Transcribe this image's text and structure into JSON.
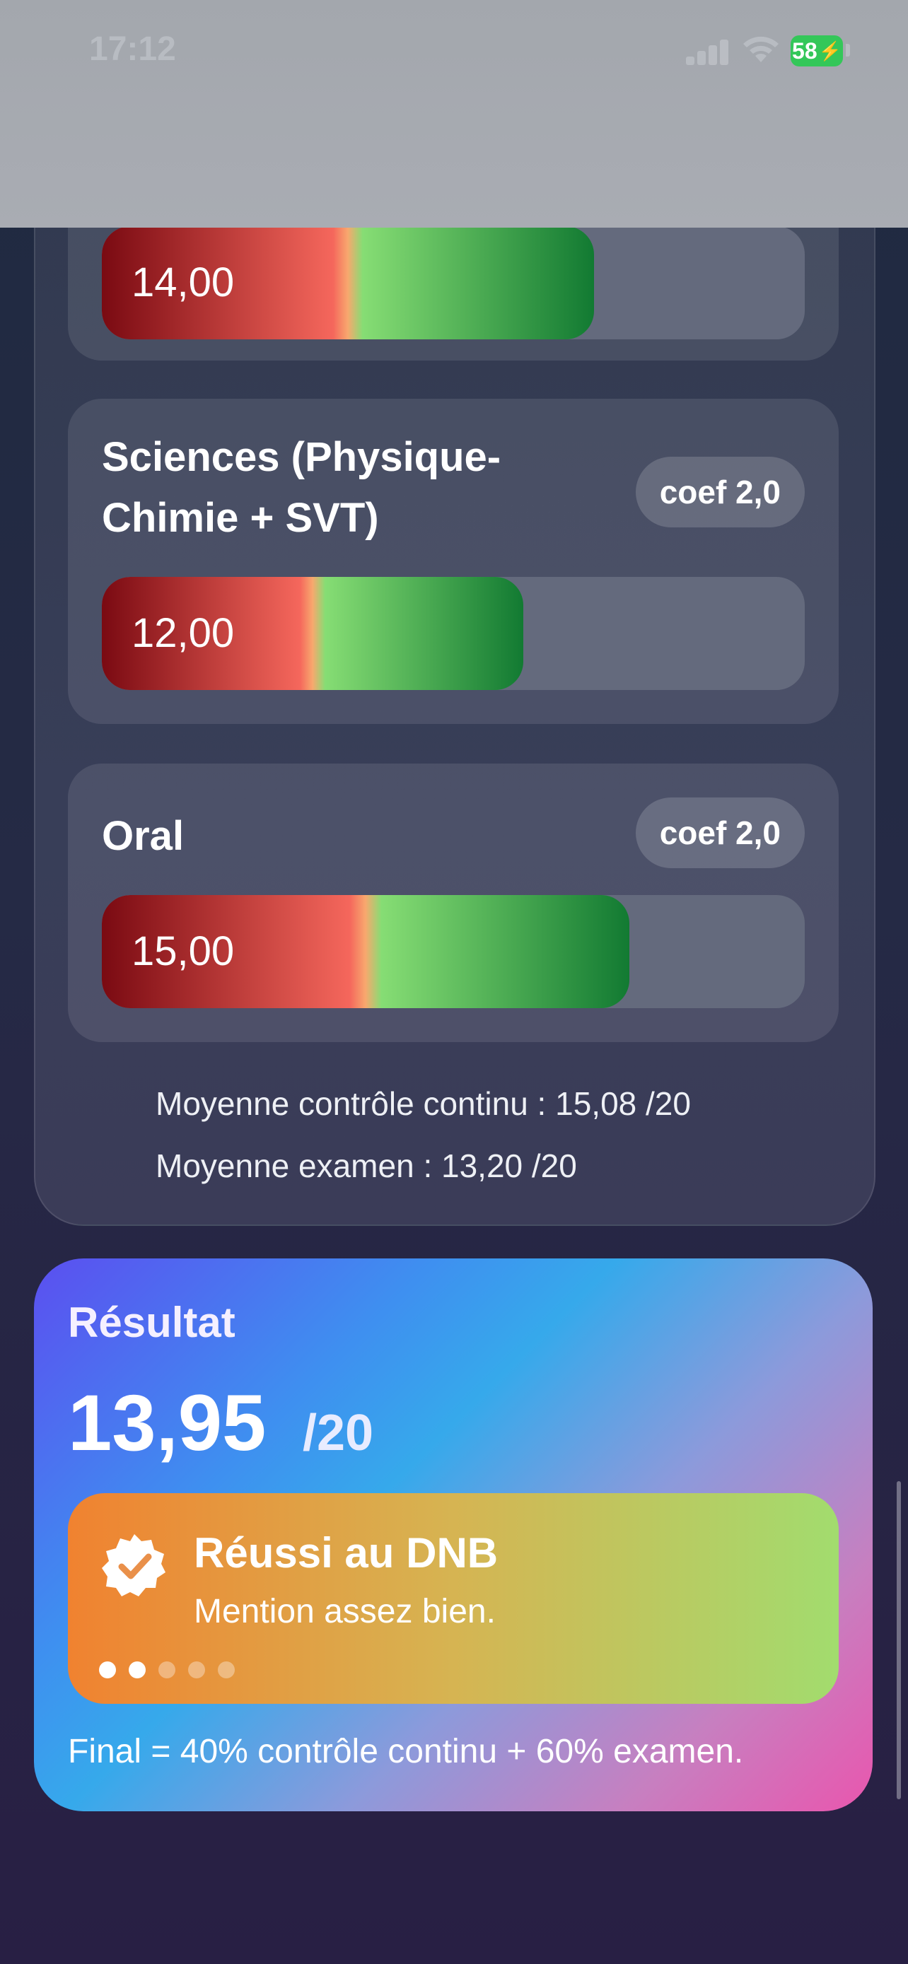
{
  "status_bar": {
    "time": "17:12",
    "battery": "58"
  },
  "subjects": [
    {
      "name": "",
      "grade": "14,00",
      "fill_fraction": 0.7
    },
    {
      "name": "Sciences (Physique-Chimie + SVT)",
      "coef": "coef 2,0",
      "grade": "12,00",
      "fill_fraction": 0.6
    },
    {
      "name": "Oral",
      "coef": "coef 2,0",
      "grade": "15,00",
      "fill_fraction": 0.75
    }
  ],
  "summary": {
    "controle_continu": "Moyenne contrôle continu : 15,08 /20",
    "examen": "Moyenne examen : 13,20 /20"
  },
  "result": {
    "label": "Résultat",
    "score": "13,95",
    "max": "/20",
    "badge_title": "Réussi au DNB",
    "badge_subtitle": "Mention assez bien.",
    "dots_active": 2,
    "dots_total": 5,
    "formula": "Final = 40% contrôle continu + 60% examen."
  },
  "colors": {
    "bar_red": "#7a0a12",
    "bar_salmon": "#f5675c",
    "bar_light_green": "#86dd74",
    "bar_dark_green": "#127a32",
    "battery_green": "#34c759"
  }
}
